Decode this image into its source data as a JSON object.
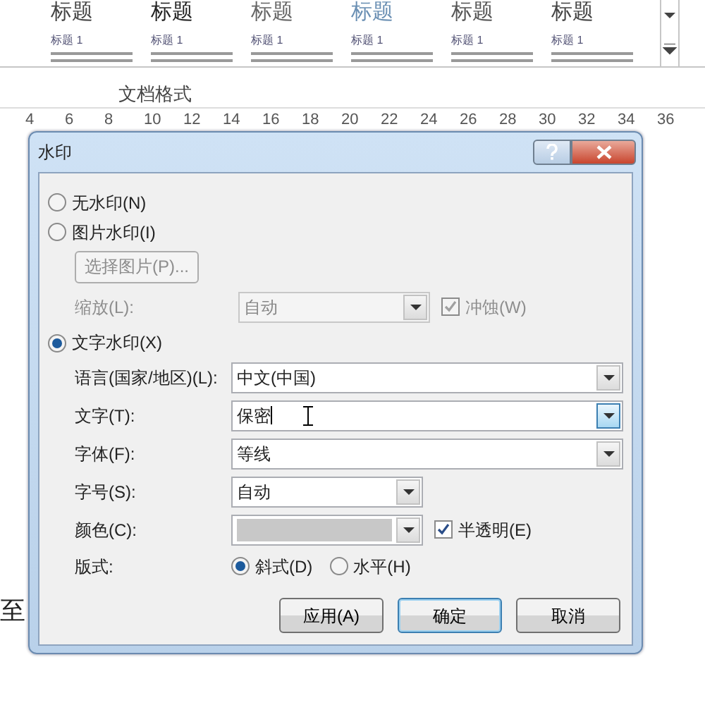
{
  "gallery": {
    "items": [
      {
        "title": "标题",
        "subtitle": "标题 1",
        "color": "#444444"
      },
      {
        "title": "标题",
        "subtitle": "标题 1",
        "color": "#222222"
      },
      {
        "title": "标题",
        "subtitle": "标题 1",
        "color": "#666666"
      },
      {
        "title": "标题",
        "subtitle": "标题 1",
        "color": "#6a8fb3"
      },
      {
        "title": "标题",
        "subtitle": "标题 1",
        "color": "#555555"
      },
      {
        "title": "标题",
        "subtitle": "标题 1",
        "color": "#444444"
      }
    ]
  },
  "group_label": "文档格式",
  "ruler": [
    "4",
    "6",
    "8",
    "10",
    "12",
    "14",
    "16",
    "18",
    "20",
    "22",
    "24",
    "26",
    "28",
    "30",
    "32",
    "34",
    "36"
  ],
  "document_text": "至",
  "dialog": {
    "title": "水印",
    "no_watermark": {
      "label": "无水印(N)",
      "selected": false
    },
    "picture_watermark": {
      "label": "图片水印(I)",
      "selected": false,
      "select_button": "选择图片(P)...",
      "scale": {
        "label": "缩放(L):",
        "value": "自动"
      },
      "washout": {
        "label": "冲蚀(W)",
        "checked": true
      },
      "disabled": true
    },
    "text_watermark": {
      "label": "文字水印(X)",
      "selected": true,
      "language": {
        "label": "语言(国家/地区)(L):",
        "value": "中文(中国)"
      },
      "text": {
        "label": "文字(T):",
        "value": "保密"
      },
      "font": {
        "label": "字体(F):",
        "value": "等线"
      },
      "size": {
        "label": "字号(S):",
        "value": "自动"
      },
      "color": {
        "label": "颜色(C):"
      },
      "semitransparent": {
        "label": "半透明(E)",
        "checked": true
      },
      "layout": {
        "label": "版式:",
        "options": [
          {
            "label": "斜式(D)",
            "selected": true
          },
          {
            "label": "水平(H)",
            "selected": false
          }
        ]
      }
    },
    "buttons": [
      {
        "label": "应用(A)",
        "default": false
      },
      {
        "label": "确定",
        "default": true
      },
      {
        "label": "取消",
        "default": false
      }
    ]
  }
}
